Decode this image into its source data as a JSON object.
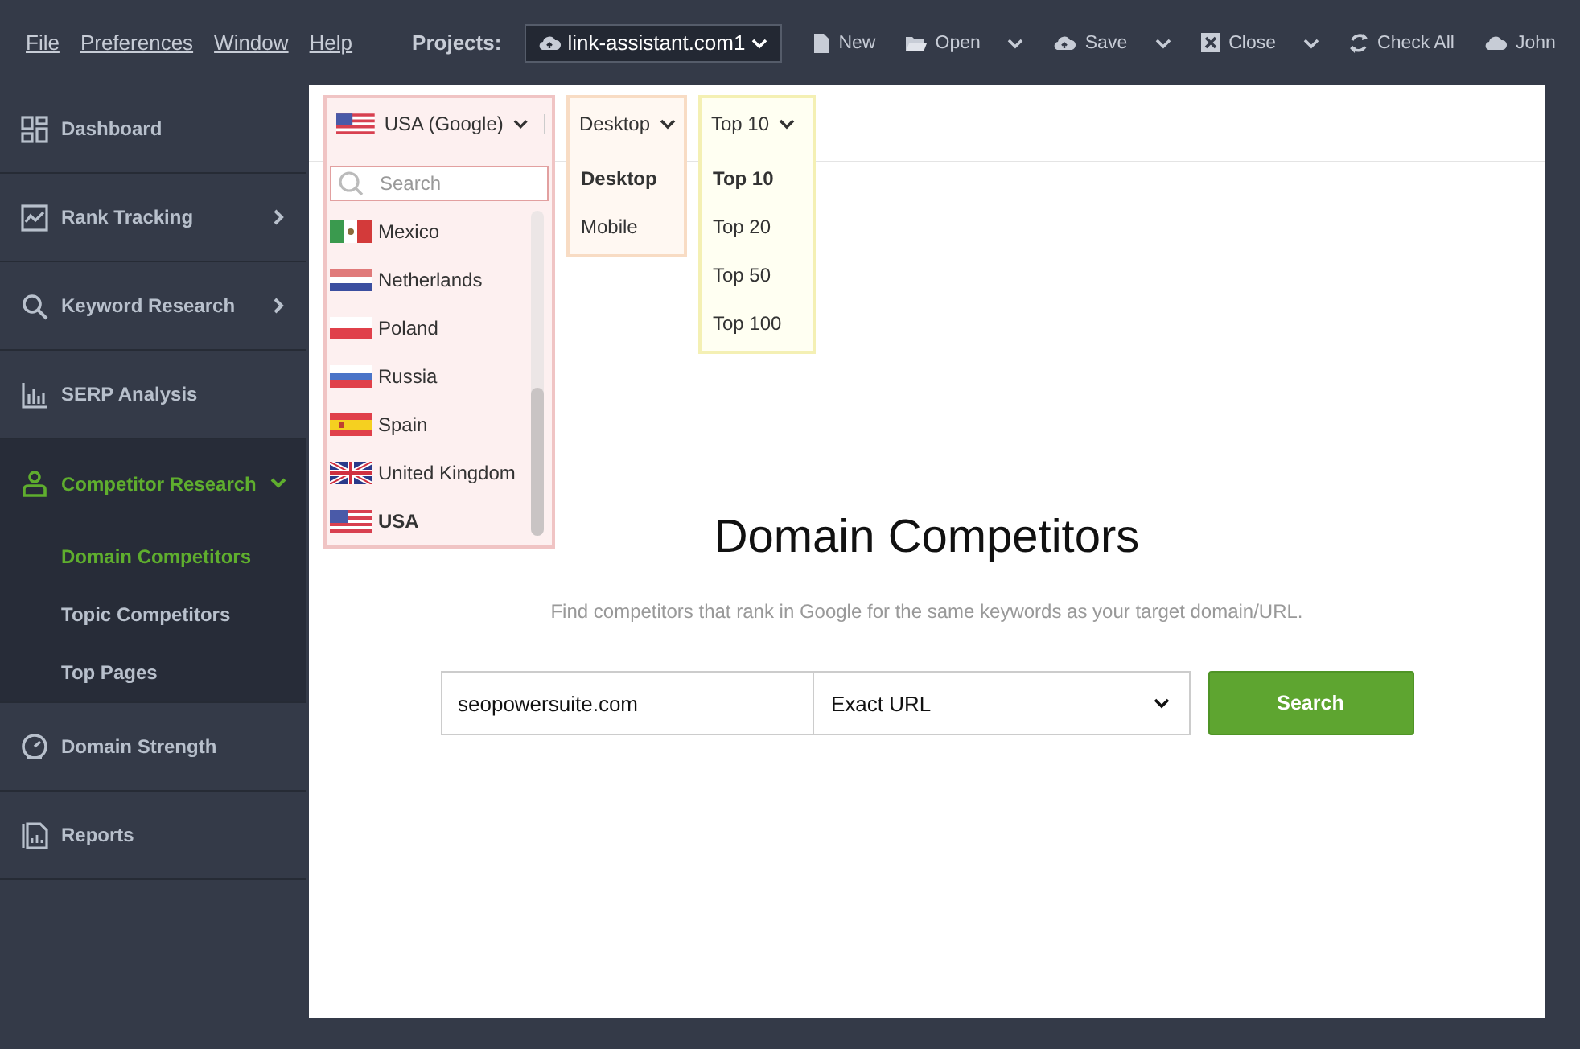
{
  "menu": [
    "File",
    "Preferences",
    "Window",
    "Help"
  ],
  "projects": {
    "label": "Projects:",
    "value": "link-assistant.com1"
  },
  "toolbar": [
    {
      "label": "New",
      "has_menu": false
    },
    {
      "label": "Open",
      "has_menu": true
    },
    {
      "label": "Save",
      "has_menu": true
    },
    {
      "label": "Close",
      "has_menu": true
    },
    {
      "label": "Check All",
      "has_menu": false
    },
    {
      "label": "John",
      "has_menu": false
    }
  ],
  "sidebar": {
    "items": [
      {
        "label": "Dashboard",
        "selected": false
      },
      {
        "label": "Rank Tracking",
        "selected": false,
        "expanded": false
      },
      {
        "label": "Keyword Research",
        "selected": false,
        "expanded": false
      },
      {
        "label": "SERP Analysis",
        "selected": false
      },
      {
        "label": "Competitor Research",
        "selected": true,
        "expanded": true,
        "children": [
          {
            "label": "Domain Competitors",
            "selected": true
          },
          {
            "label": "Topic Competitors",
            "selected": false
          },
          {
            "label": "Top Pages",
            "selected": false
          }
        ]
      },
      {
        "label": "Domain Strength",
        "selected": false
      },
      {
        "label": "Reports",
        "selected": false
      }
    ]
  },
  "filters": [
    {
      "kind": "country",
      "value": "USA (Google)",
      "search": {
        "placeholder": "Search"
      },
      "options": [
        {
          "label": "Mexico",
          "selected": false
        },
        {
          "label": "Netherlands",
          "selected": false
        },
        {
          "label": "Poland",
          "selected": false
        },
        {
          "label": "Russia",
          "selected": false
        },
        {
          "label": "Spain",
          "selected": false
        },
        {
          "label": "United Kingdom",
          "selected": false
        },
        {
          "label": "USA",
          "selected": true
        }
      ]
    },
    {
      "kind": "device",
      "value": "Desktop",
      "options": [
        {
          "label": "Desktop",
          "selected": true
        },
        {
          "label": "Mobile",
          "selected": false
        }
      ]
    },
    {
      "kind": "depth",
      "value": "Top 10",
      "options": [
        {
          "label": "Top 10",
          "selected": true
        },
        {
          "label": "Top 20",
          "selected": false
        },
        {
          "label": "Top 50",
          "selected": false
        },
        {
          "label": "Top 100",
          "selected": false
        }
      ]
    }
  ],
  "heading": "Domain Competitors",
  "subtitle": "Find competitors that rank in Google for the same keywords as your target domain/URL.",
  "search_form": {
    "domain": {
      "value": "seopowersuite.com"
    },
    "scope": {
      "value": "Exact URL"
    },
    "button": "Search"
  }
}
